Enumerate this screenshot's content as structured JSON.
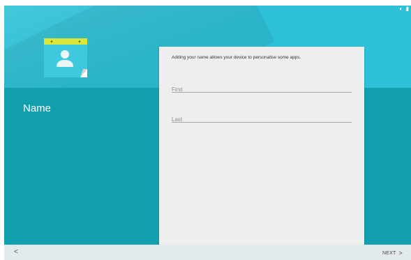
{
  "status_bar": {
    "icons": "◐ ▮"
  },
  "page": {
    "title": "Name"
  },
  "illustration": {
    "icon": "contact-card-icon"
  },
  "form": {
    "description": "Adding your name allows your device to personalise some apps.",
    "first_name": {
      "placeholder": "First",
      "value": ""
    },
    "last_name": {
      "placeholder": "Last",
      "value": ""
    }
  },
  "navigation": {
    "back_label": "<",
    "next_label": "NEXT",
    "next_chevron": ">"
  },
  "colors": {
    "header": "#2ec0d6",
    "body": "#129fae",
    "card": "#eeeeee",
    "nav": "#e3eaeb",
    "tab_yellow": "#d9e63a"
  }
}
